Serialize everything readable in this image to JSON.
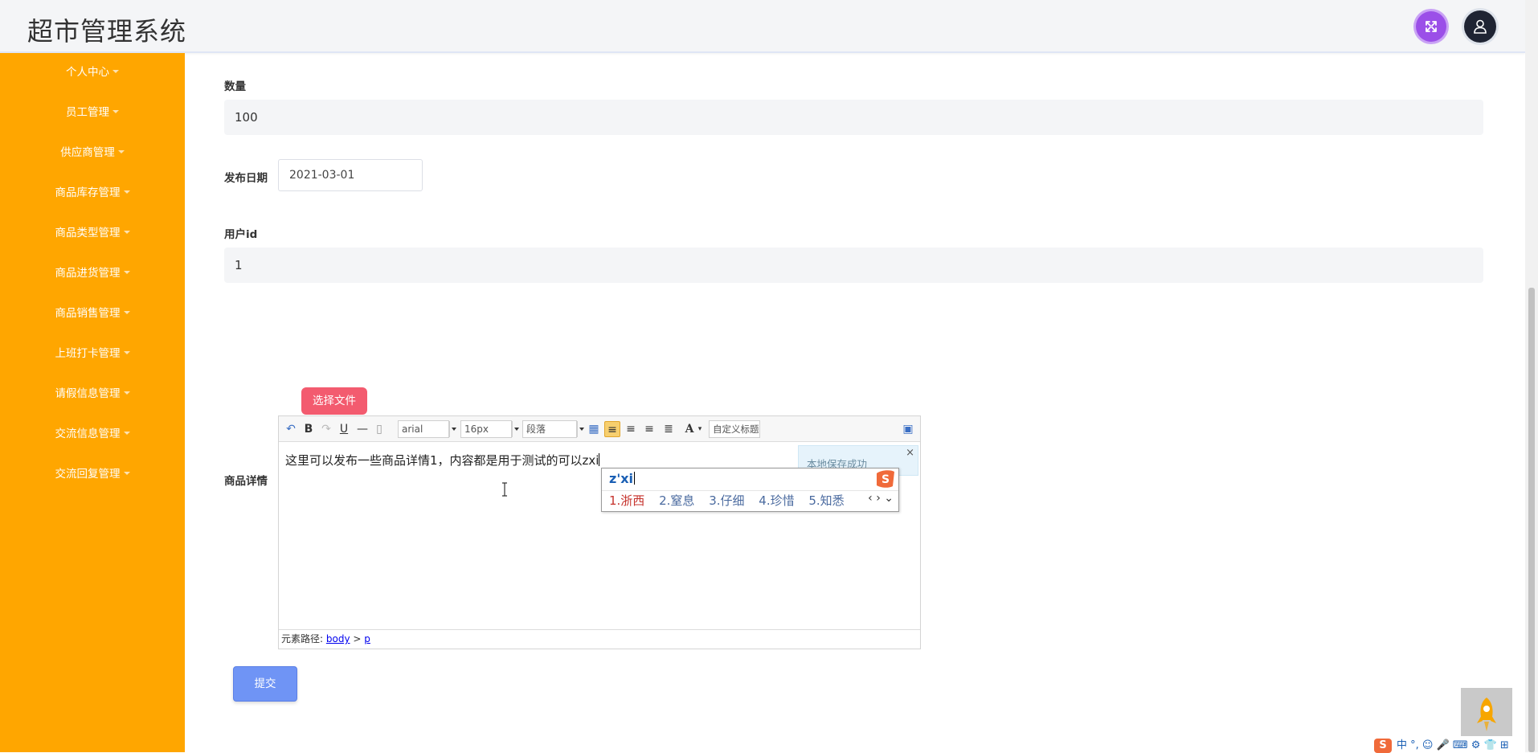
{
  "header": {
    "app_title": "超市管理系统",
    "fullscreen_icon": "expand-arrows-icon",
    "user_icon": "user-avatar-icon",
    "fullscreen_color": "#9b4fe8"
  },
  "sidebar": {
    "background": "#ffa600",
    "items": [
      {
        "label": "个人中心"
      },
      {
        "label": "员工管理"
      },
      {
        "label": "供应商管理"
      },
      {
        "label": "商品库存管理"
      },
      {
        "label": "商品类型管理"
      },
      {
        "label": "商品进货管理"
      },
      {
        "label": "商品销售管理"
      },
      {
        "label": "上班打卡管理"
      },
      {
        "label": "请假信息管理"
      },
      {
        "label": "交流信息管理"
      },
      {
        "label": "交流回复管理"
      }
    ]
  },
  "form": {
    "quantity": {
      "label": "数量",
      "value": "100"
    },
    "publish_date": {
      "label": "发布日期",
      "value": "2021-03-01"
    },
    "user_id": {
      "label": "用户id",
      "value": "1"
    },
    "detail": {
      "label": "商品详情",
      "choose_file_label": "选择文件",
      "content": "这里可以发布一些商品详情1，内容都是用于测试的可以zxi",
      "toolbar": {
        "font_family": "arial",
        "font_size": "16px",
        "paragraph": "段落",
        "custom_title": "自定义标题",
        "bold": "B",
        "underline": "U",
        "font_color": "A"
      },
      "save_toast": "本地保存成功",
      "toast_close": "×",
      "status_prefix": "元素路径:",
      "path_body": "body",
      "path_sep": ">",
      "path_p": "p"
    },
    "submit_label": "提交"
  },
  "ime": {
    "input": "z'xi",
    "candidates": [
      "1.浙西",
      "2.窒息",
      "3.仔细",
      "4.珍惜",
      "5.知悉"
    ],
    "nav": "‹ › ⌄"
  },
  "tray": {
    "text": "中 °, ☺ 🎤 ⌨ ⚙ 👕 ⊞"
  }
}
